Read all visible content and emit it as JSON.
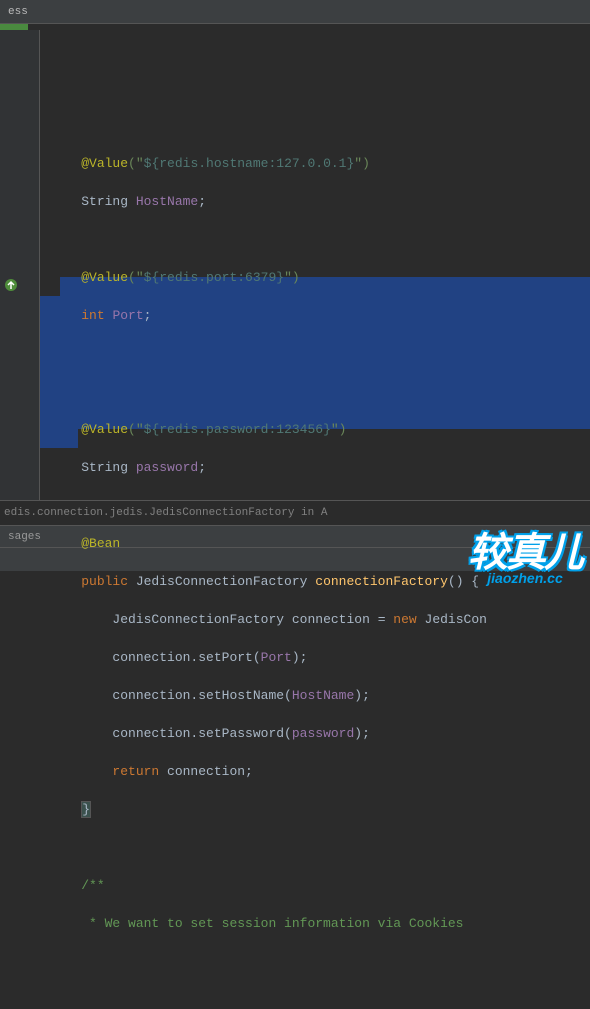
{
  "topbar": {
    "text": "ess"
  },
  "code": {
    "indent1": "    ",
    "indent2": "        ",
    "indent3": "            ",
    "value_anno": "@Value",
    "hostname_str_open": "(\"",
    "hostname_var": "${redis.hostname:127.0.0.1}",
    "hostname_str_close": "\")",
    "string_kw": "String ",
    "hostname_field": "HostName",
    "semi": ";",
    "port_var": "${redis.port:6379}",
    "int_kw": "int ",
    "port_field": "Port",
    "password_var": "${redis.password:123456}",
    "password_field": "password",
    "bean_anno": "@Bean",
    "public_kw": "public ",
    "factory_type": "JedisConnectionFactory ",
    "factory_method": "connectionFactory",
    "method_parens": "() {",
    "conn_decl_type": "JedisConnectionFactory ",
    "conn_var": "connection ",
    "eq_new": "= ",
    "new_kw": "new ",
    "new_type": "JedisCon",
    "setport": "connection.setPort(",
    "port_arg": "Port",
    "close_paren_semi": ");",
    "sethostname": "connection.setHostName(",
    "hostname_arg": "HostName",
    "setpassword": "connection.setPassword(",
    "password_arg": "password",
    "return_kw": "return ",
    "return_var": "connection;",
    "close_brace": "}",
    "comment_start": "/**",
    "comment_line": " * We want to set session information via Cookies"
  },
  "bottom": {
    "class_path": "edis.connection.jedis.JedisConnectionFactory in A"
  },
  "tabs": {
    "label": "sages"
  },
  "watermark": {
    "cn": "较真儿",
    "py": "jiaozhen.cc"
  }
}
